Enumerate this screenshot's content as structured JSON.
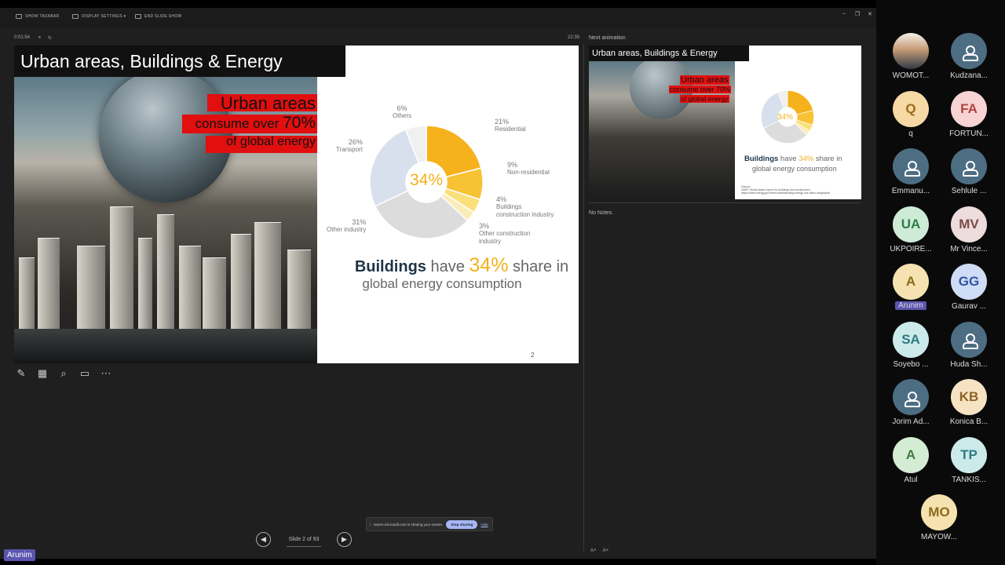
{
  "toolbar": {
    "show_taskbar": "SHOW TASKBAR",
    "display_settings": "DISPLAY SETTINGS ▾",
    "end_slide_show": "END SLIDE SHOW"
  },
  "presenter": {
    "elapsed": "0:01:54",
    "clock": "22:39",
    "next_label": "Next animation",
    "notes": "No Notes.",
    "slide_counter": "Slide 2 of 93"
  },
  "slide": {
    "title": "Urban areas, Buildings & Energy",
    "urban_line1": "Urban areas",
    "urban_line2_pre": "consume over ",
    "urban_line2_num": "70%",
    "urban_line3": "of global energy",
    "center_pct": "34%",
    "caption_bold": "Buildings",
    "caption_have": " have ",
    "caption_pct": "34%",
    "caption_share": " share in",
    "caption_line2": "global energy consumption",
    "page_number": "2",
    "source_label": "Source:",
    "source_text": "UNEP Global status report for buildings and construction",
    "source_url": "https://www.energy.gov/eere/understanding-energy-use-cities-infographic"
  },
  "chart_data": {
    "type": "pie",
    "title": "",
    "center_label": "34%",
    "slices": [
      {
        "label": "Residential",
        "value": 21,
        "color": "#f5b21c"
      },
      {
        "label": "Non-residential",
        "value": 9,
        "color": "#f7c233"
      },
      {
        "label": "Buildings construction industry",
        "value": 4,
        "color": "#fae07a"
      },
      {
        "label": "Other construction industry",
        "value": 3,
        "color": "#fbedb8"
      },
      {
        "label": "Other industry",
        "value": 31,
        "color": "#dcdcdc"
      },
      {
        "label": "Transport",
        "value": 26,
        "color": "#d7e0ec"
      },
      {
        "label": "Others",
        "value": 6,
        "color": "#f0f0f0"
      }
    ]
  },
  "share_bar": {
    "message": "teams.microsoft.com is sharing your screen.",
    "stop": "Stop sharing",
    "hide": "Hide"
  },
  "current_speaker": "Arunim",
  "participants": [
    {
      "initials": "",
      "name": "WOMOT...",
      "avatar": "photo"
    },
    {
      "initials": "",
      "name": "Kudzana...",
      "avatar": "person"
    },
    {
      "initials": "Q",
      "name": "q",
      "bg": "#f6d9a4",
      "fg": "#9a6a1c"
    },
    {
      "initials": "FA",
      "name": "FORTUN...",
      "bg": "#f7d3d3",
      "fg": "#b3413f"
    },
    {
      "initials": "",
      "name": "Emmanu...",
      "avatar": "person"
    },
    {
      "initials": "",
      "name": "Sehlule ...",
      "avatar": "person"
    },
    {
      "initials": "UA",
      "name": "UKPOIRE...",
      "bg": "#cdebd6",
      "fg": "#2e7d4b"
    },
    {
      "initials": "MV",
      "name": "Mr Vince...",
      "bg": "#ecdcdc",
      "fg": "#7b4b4b"
    },
    {
      "initials": "A",
      "name": "Arunim",
      "bg": "#f6e2b0",
      "fg": "#8c6a1a",
      "highlight": true
    },
    {
      "initials": "GG",
      "name": "Gaurav ...",
      "bg": "#cfdcf5",
      "fg": "#2f55a4"
    },
    {
      "initials": "SA",
      "name": "Soyebo ...",
      "bg": "#cdeaeb",
      "fg": "#2d7b80"
    },
    {
      "initials": "",
      "name": "Huda Sh...",
      "avatar": "person"
    },
    {
      "initials": "",
      "name": "Jorim Ad...",
      "avatar": "person"
    },
    {
      "initials": "KB",
      "name": "Konica B...",
      "bg": "#f6e3c4",
      "fg": "#8e6321"
    },
    {
      "initials": "A",
      "name": "Atul",
      "bg": "#d4ecd3",
      "fg": "#3f7b3e"
    },
    {
      "initials": "TP",
      "name": "TANKIS...",
      "bg": "#cdeaeb",
      "fg": "#2d7b80"
    },
    {
      "initials": "MO",
      "name": "MAYOW...",
      "bg": "#f6e2b0",
      "fg": "#8c6a1a"
    }
  ]
}
